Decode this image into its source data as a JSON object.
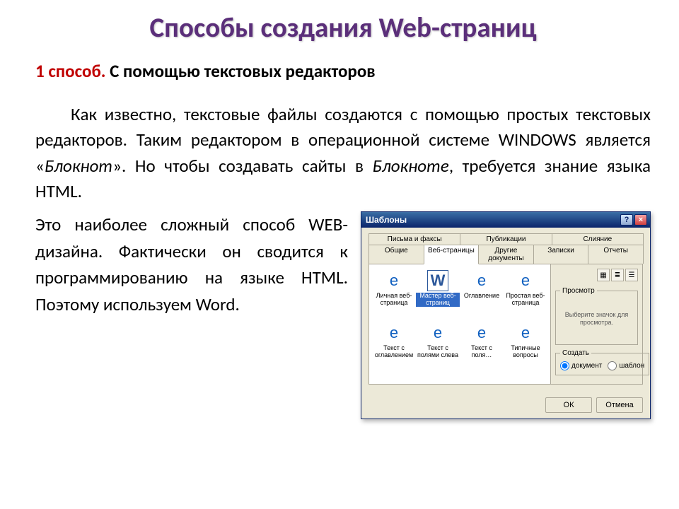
{
  "title": "Способы создания Web-страниц",
  "method": {
    "num": "1 способ.",
    "rest": " С помощью текстовых редакторов"
  },
  "p1a": "Как известно, текстовые файлы создаются с помощью простых текстовых редакторов. Таким редактором в операционной системе WINDOWS является «",
  "p1_ital1": "Блокнот",
  "p1b": "». Но чтобы создавать сайты в ",
  "p1_ital2": "Блокноте",
  "p1c": ", требуется знание языка HTML.",
  "p2": "Это наиболее сложный способ WEB-дизайна. Фактически он сводится к программированию на языке HTML. Поэтому используем Word.",
  "dialog": {
    "title": "Шаблоны",
    "tabs_top": [
      "Письма и факсы",
      "Публикации",
      "Слияние"
    ],
    "tabs_bottom": [
      "Общие",
      "Веб-страницы",
      "Другие документы",
      "Записки",
      "Отчеты"
    ],
    "active_tab": "Веб-страницы",
    "icons": [
      {
        "label": "Личная веб-страница",
        "type": "ie"
      },
      {
        "label": "Мастер веб-страниц",
        "type": "word",
        "selected": true
      },
      {
        "label": "Оглавление",
        "type": "ie"
      },
      {
        "label": "Простая веб-страница",
        "type": "ie"
      },
      {
        "label": "Текст с оглавлением",
        "type": "ie"
      },
      {
        "label": "Текст с полями слева",
        "type": "ie"
      },
      {
        "label": "Текст с поля…",
        "type": "ie"
      },
      {
        "label": "Типичные вопросы",
        "type": "ie"
      }
    ],
    "preview_legend": "Просмотр",
    "preview_text": "Выберите значок для просмотра.",
    "create_legend": "Создать",
    "radio_doc": "документ",
    "radio_tpl": "шаблон",
    "ok": "ОК",
    "cancel": "Отмена"
  }
}
